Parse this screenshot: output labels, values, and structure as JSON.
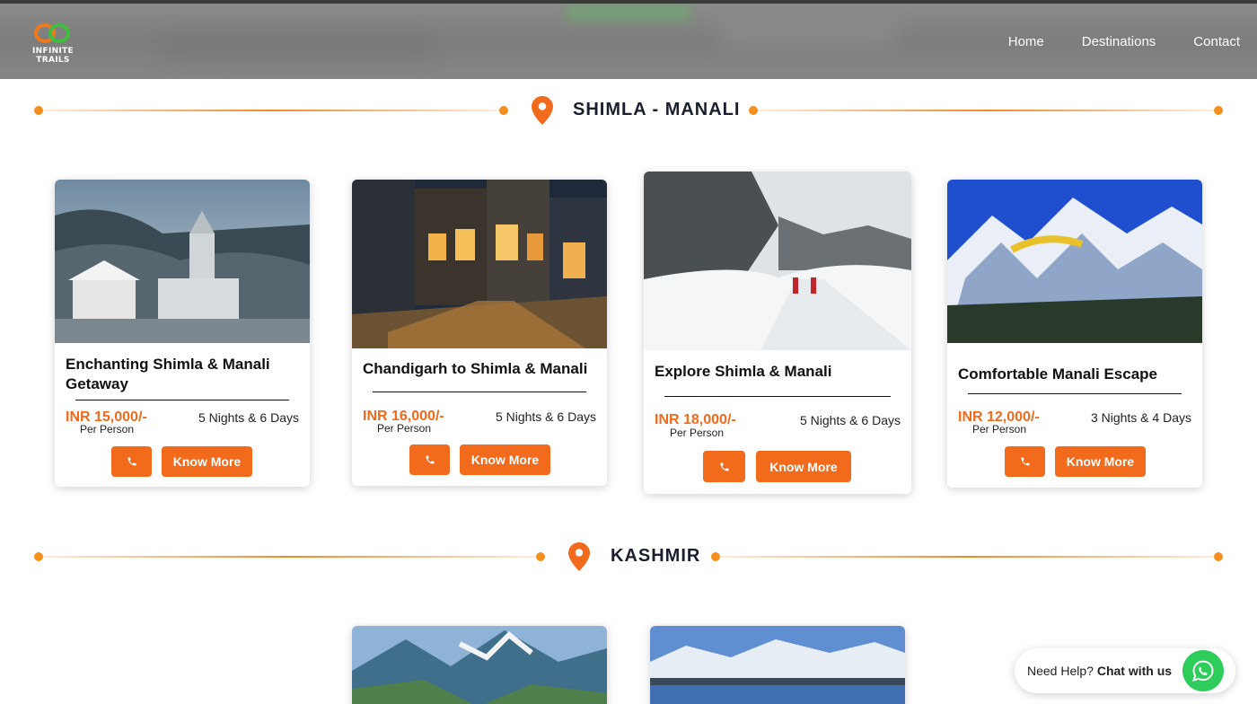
{
  "brand": {
    "logo_text": "INFINITE TRAILS"
  },
  "nav": {
    "items": [
      "Home",
      "Destinations",
      "Contact"
    ]
  },
  "sections": [
    {
      "title": "SHIMLA - MANALI"
    },
    {
      "title": "KASHMIR"
    }
  ],
  "cards": [
    {
      "title": "Enchanting Shimla & Manali Getaway",
      "price": "INR 15,000/-",
      "per": "Per Person",
      "duration": "5 Nights & 6 Days",
      "cta": "Know More"
    },
    {
      "title": "Chandigarh to Shimla & Manali",
      "price": "INR 16,000/-",
      "per": "Per Person",
      "duration": "5 Nights & 6 Days",
      "cta": "Know More"
    },
    {
      "title": "Explore Shimla & Manali",
      "price": "INR 18,000/-",
      "per": "Per Person",
      "duration": "5 Nights & 6 Days",
      "cta": "Know More"
    },
    {
      "title": "Comfortable Manali Escape",
      "price": "INR 12,000/-",
      "per": "Per Person",
      "duration": "3 Nights & 4 Days",
      "cta": "Know More"
    }
  ],
  "help": {
    "prefix": "Need Help?",
    "action": "Chat with us"
  },
  "colors": {
    "accent": "#f26a1b",
    "whatsapp": "#2ecc5a",
    "heading": "#1a1f2e"
  }
}
